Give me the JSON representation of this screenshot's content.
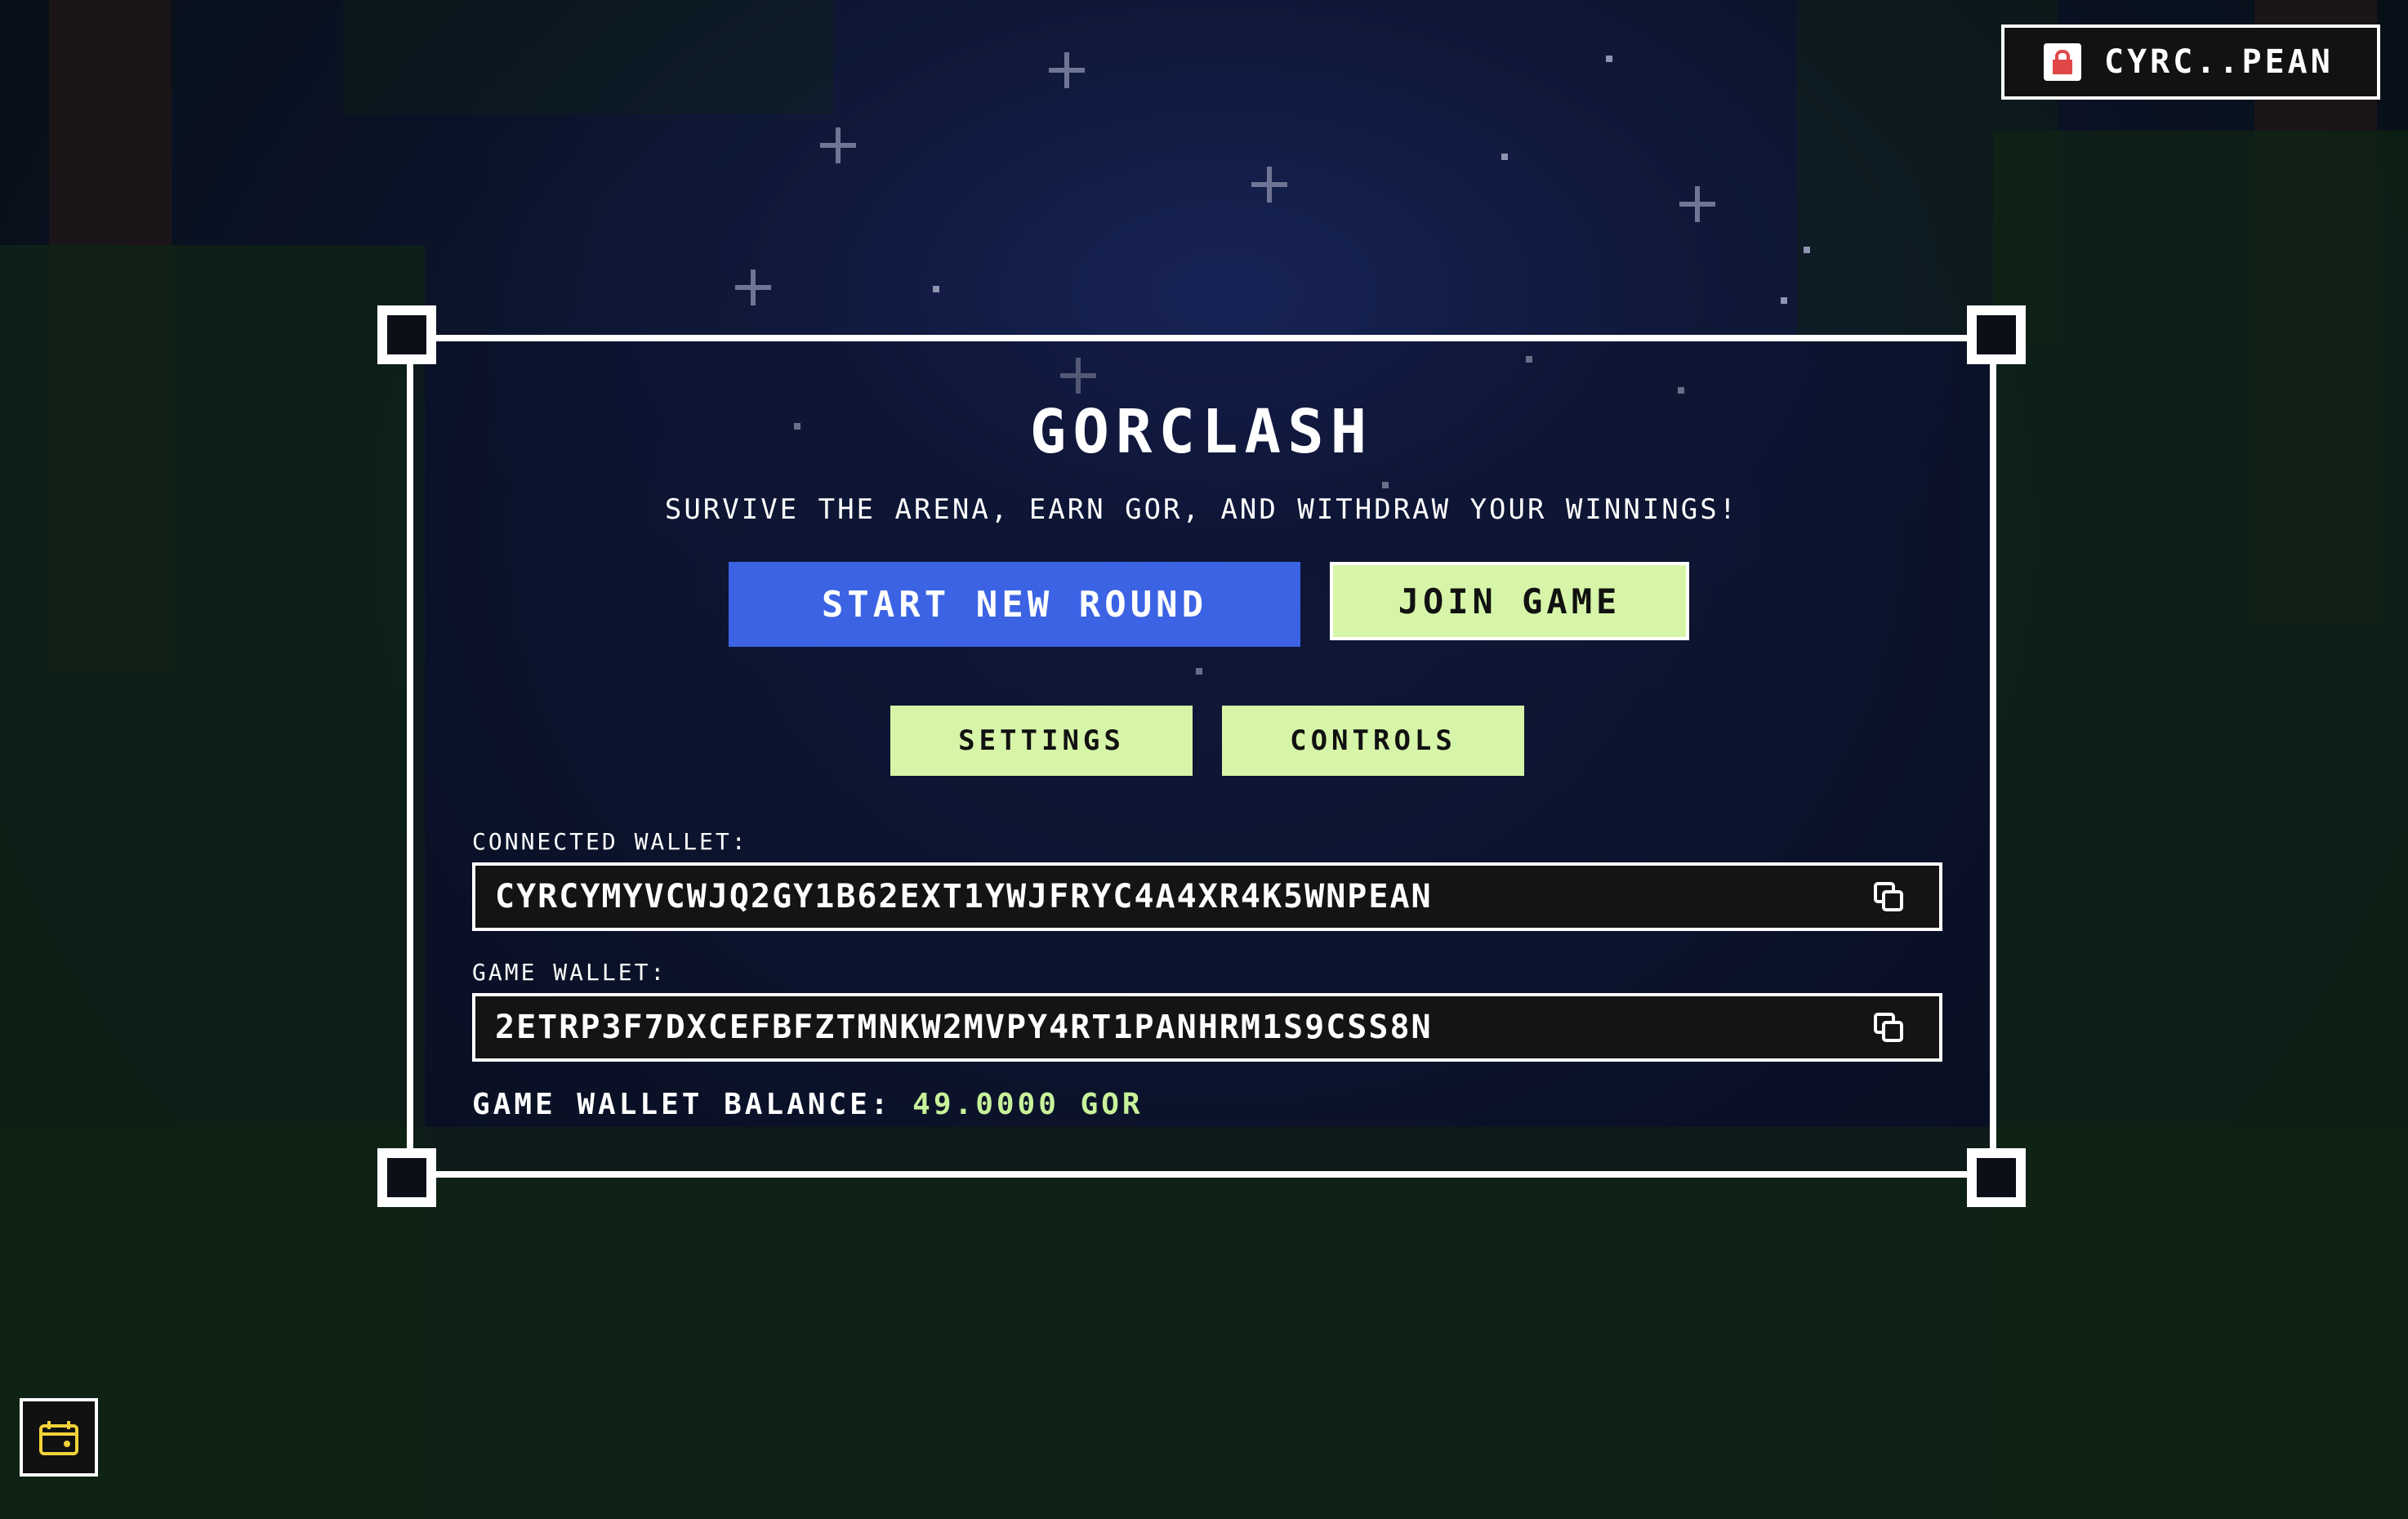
{
  "app": {
    "title": "GORCLASH",
    "subtitle": "SURVIVE THE ARENA, EARN GOR, AND WITHDRAW YOUR WINNINGS!"
  },
  "header": {
    "wallet_badge_label": "CYRC..PEAN",
    "wallet_badge_icon": "lock-icon"
  },
  "actions": {
    "start_label": "START NEW ROUND",
    "join_label": "JOIN GAME",
    "settings_label": "SETTINGS",
    "controls_label": "CONTROLS"
  },
  "wallets": {
    "connected_label": "CONNECTED WALLET:",
    "connected_value": "CYRCYMYVCWJQ2GY1B62EXT1YWJFRYC4A4XR4K5WNPEAN",
    "game_label": "GAME WALLET:",
    "game_value": "2ETRP3F7DXCEFBFZTMNKW2MVPY4RT1PANHRM1S9CSS8N",
    "copy_icon": "copy-icon"
  },
  "balance": {
    "label": "GAME WALLET BALANCE:",
    "amount": "49.0000 GOR"
  },
  "footer": {
    "bottom_button_icon": "wallet-icon"
  },
  "colors": {
    "primary_button": "#3b63e4",
    "secondary_button": "#d6f5a8",
    "balance_amount": "#c8f29a",
    "lock": "#e04848",
    "bottom_icon": "#f2d23a"
  }
}
